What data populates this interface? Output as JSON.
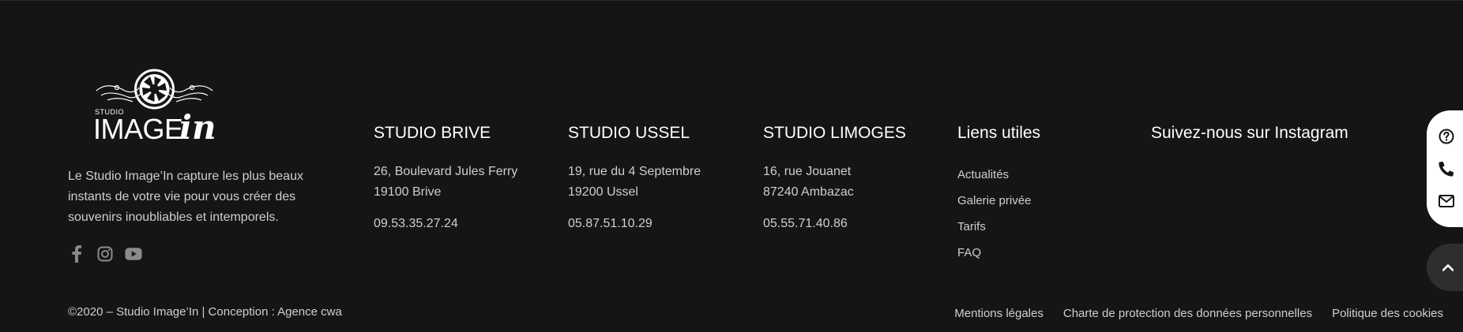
{
  "logo": {
    "studio": "STUDIO",
    "image": "IMAGE",
    "in": "in"
  },
  "about_text": "Le Studio Image’In capture les plus beaux instants de votre vie pour vous créer des souvenirs inoubliables et intemporels.",
  "socials": [
    "facebook-icon",
    "instagram-icon",
    "youtube-icon"
  ],
  "studios": [
    {
      "title": "STUDIO BRIVE",
      "address1": "26, Boulevard Jules Ferry",
      "address2": "19100 Brive",
      "phone": "09.53.35.27.24"
    },
    {
      "title": "STUDIO USSEL",
      "address1": "19, rue du 4 Septembre",
      "address2": "19200 Ussel",
      "phone": "05.87.51.10.29"
    },
    {
      "title": "STUDIO LIMOGES",
      "address1": "16, rue Jouanet",
      "address2": "87240 Ambazac",
      "phone": "05.55.71.40.86"
    }
  ],
  "useful_links": {
    "title": "Liens utiles",
    "items": [
      "Actualités",
      "Galerie privée",
      "Tarifs",
      "FAQ"
    ]
  },
  "instagram_title": "Suivez-nous sur Instagram",
  "copyright": "©2020 – Studio Image’In | Conception : Agence cwa",
  "legal_links": [
    "Mentions légales",
    "Charte de protection des données personnelles",
    "Politique des cookies"
  ],
  "contact_widget": [
    "question-icon",
    "phone-icon",
    "mail-icon"
  ],
  "scroll_top_icon": "chevron-up-icon",
  "colors": {
    "background": "#151515",
    "text": "#cfcfcf",
    "heading": "#ffffff",
    "icon_grey": "#8a8a8a"
  }
}
